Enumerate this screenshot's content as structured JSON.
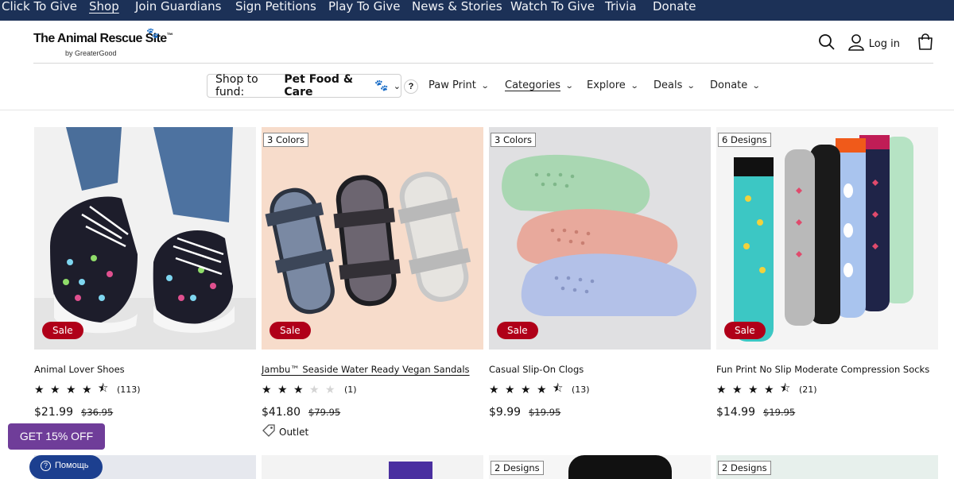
{
  "topnav": {
    "items": [
      "Click To Give",
      "Shop",
      "Join Guardians",
      "Sign Petitions",
      "Play To Give",
      "News & Stories",
      "Watch To Give",
      "Trivia",
      "Donate"
    ],
    "active": "Shop"
  },
  "header": {
    "logo_title": "The Animal Rescue Site",
    "logo_tm": "™",
    "logo_sub": "by GreaterGood",
    "login_label": "Log in"
  },
  "subnav": {
    "fund_label": "Shop to fund:",
    "fund_value": "Pet Food & Care",
    "help_q": "?",
    "items": [
      "Paw Print",
      "Categories",
      "Explore",
      "Deals",
      "Donate"
    ]
  },
  "products": [
    {
      "badge": "",
      "sale": "Sale",
      "name": "Animal Lover Shoes",
      "rating": 4.5,
      "reviews": "(113)",
      "price": "$21.99",
      "orig": "$36.95",
      "outlet": ""
    },
    {
      "badge": "3 Colors",
      "sale": "Sale",
      "name": "Jambu™ Seaside Water Ready Vegan Sandals",
      "rating": 3,
      "reviews": "(1)",
      "price": "$41.80",
      "orig": "$79.95",
      "outlet": "Outlet"
    },
    {
      "badge": "3 Colors",
      "sale": "Sale",
      "name": "Casual Slip-On Clogs",
      "rating": 4.5,
      "reviews": "(13)",
      "price": "$9.99",
      "orig": "$19.95",
      "outlet": ""
    },
    {
      "badge": "6 Designs",
      "sale": "Sale",
      "name": "Fun Print No Slip Moderate Compression Socks",
      "rating": 4.5,
      "reviews": "(21)",
      "price": "$14.99",
      "orig": "$19.95",
      "outlet": ""
    }
  ],
  "bottom_badges": [
    "2 Designs",
    "2 Designs"
  ],
  "promo": {
    "label": "GET 15% OFF"
  },
  "help": {
    "label": "Помощь"
  }
}
